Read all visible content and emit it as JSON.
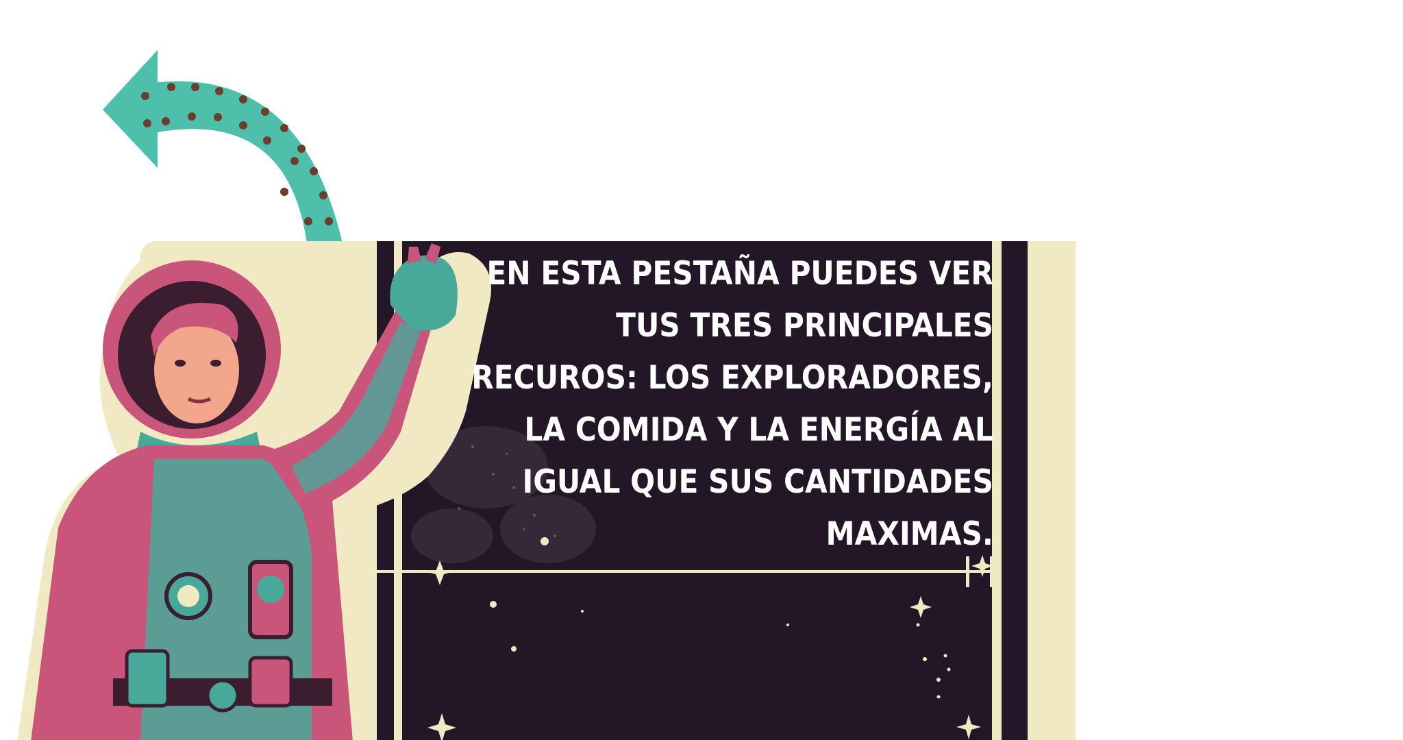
{
  "tutorial": {
    "message": "EN ESTA PESTAÑA PUEDES VER TUS TRES PRINCIPALES RECUROS: LOS EXPLORADORES, LA COMIDA Y LA ENERGÍA AL IGUAL QUE SUS CANTIDADES MAXIMAS."
  },
  "icons": {
    "back_arrow": "curved-back-arrow-icon",
    "character": "astronaut-guide-illustration"
  },
  "colors": {
    "arrow": "#4dbfaa",
    "arrow_dots": "#6b3d2c",
    "panel_cream": "#f1e9c4",
    "panel_dark": "#231727",
    "suit_pink": "#c9567a",
    "suit_teal": "#48a89a",
    "text": "#ffffff"
  }
}
